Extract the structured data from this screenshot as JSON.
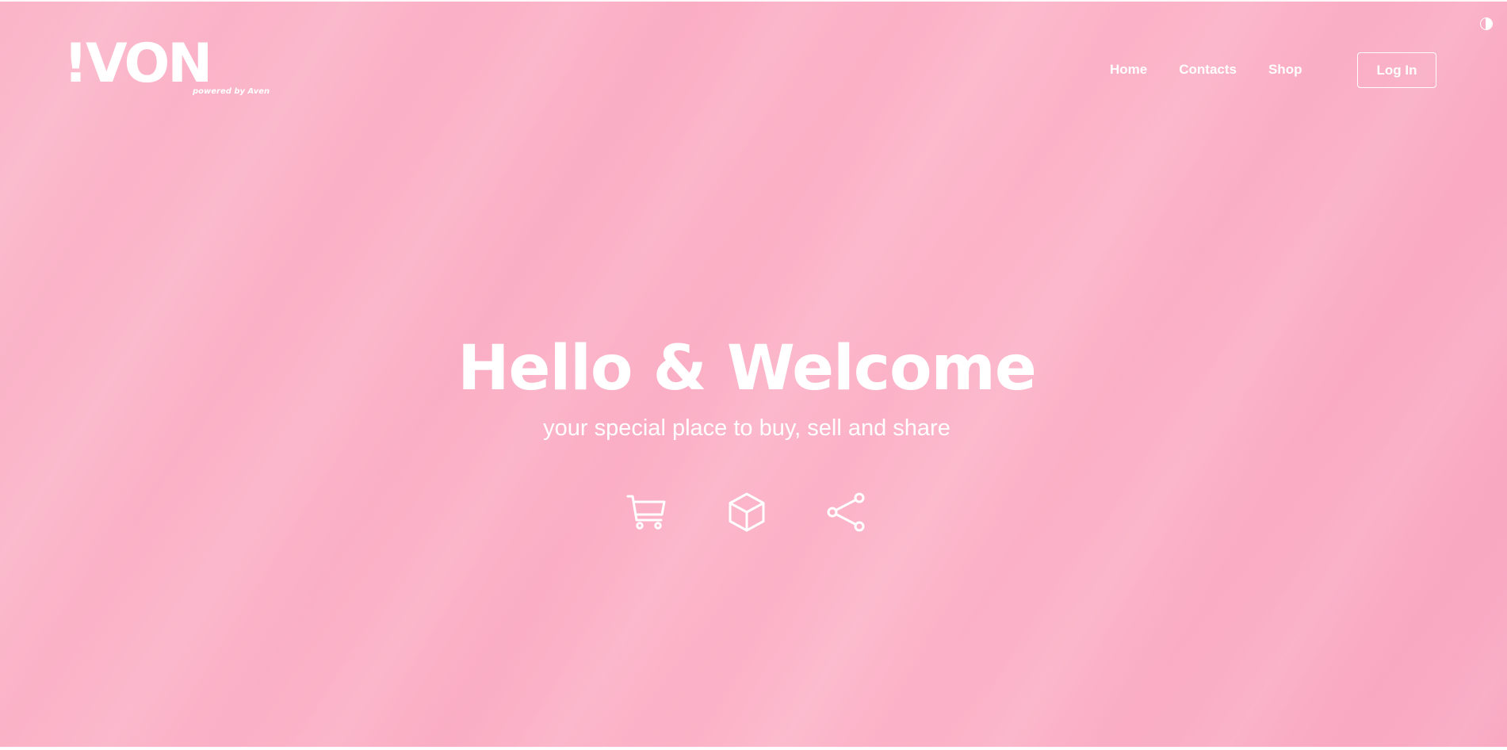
{
  "brand": {
    "logo_text": "!VON",
    "tagline": "powered by Aven"
  },
  "nav": {
    "items": [
      {
        "label": "Home"
      },
      {
        "label": "Contacts"
      },
      {
        "label": "Shop"
      }
    ],
    "login_label": "Log In"
  },
  "hero": {
    "title": "Hello & Welcome",
    "subtitle": "your special place to buy, sell and share",
    "icons": [
      "cart-icon",
      "box-icon",
      "share-icon"
    ]
  },
  "theme": {
    "toggle_icon": "contrast-icon",
    "background_color": "#fbb3c8",
    "foreground_color": "#ffffff"
  }
}
